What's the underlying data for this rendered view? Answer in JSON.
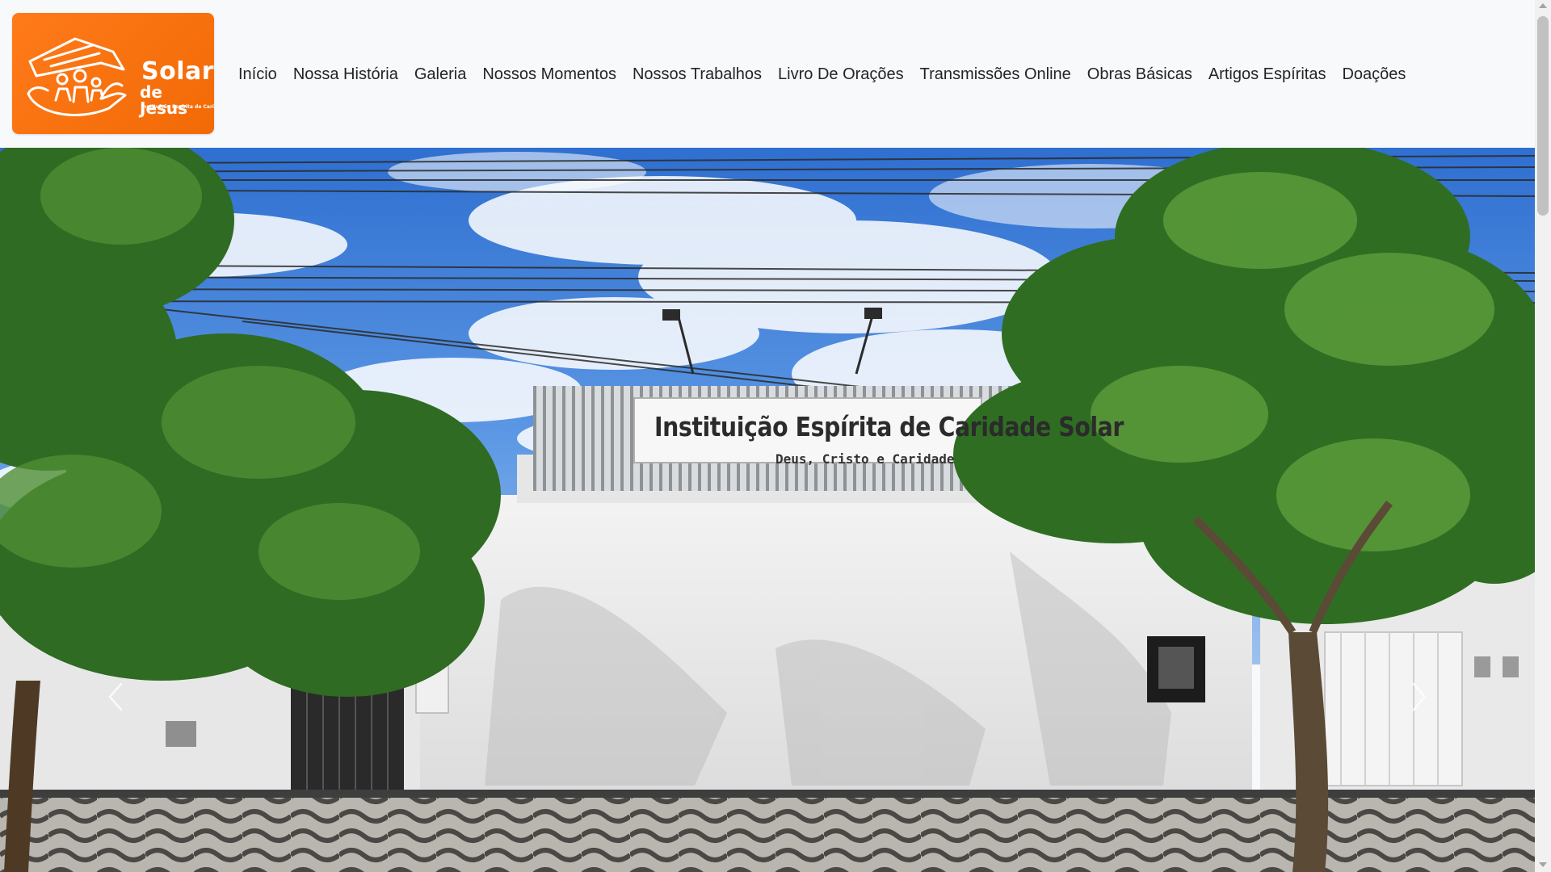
{
  "brand": {
    "title": "Solar",
    "subtitle": "de Jesus",
    "tagline": "Instituição Espírita de Caridade",
    "color": "#f26a06"
  },
  "nav": {
    "items": [
      {
        "label": "Início"
      },
      {
        "label": "Nossa História"
      },
      {
        "label": "Galeria"
      },
      {
        "label": "Nossos Momentos"
      },
      {
        "label": "Nossos Trabalhos"
      },
      {
        "label": "Livro De Orações"
      },
      {
        "label": "Transmissões Online"
      },
      {
        "label": "Obras Básicas"
      },
      {
        "label": "Artigos Espíritas"
      },
      {
        "label": "Doações"
      }
    ]
  },
  "hero": {
    "sign_title": "Instituição Espírita de Caridade Solar",
    "sign_subtitle": "Deus, Cristo e Caridade",
    "prev_icon": "chevron-left-icon",
    "next_icon": "chevron-right-icon"
  },
  "colors": {
    "navbar_bg": "#f8f9fa",
    "nav_text": "#212529",
    "sky": "#3d7fd8",
    "wall": "#eeeeee"
  }
}
